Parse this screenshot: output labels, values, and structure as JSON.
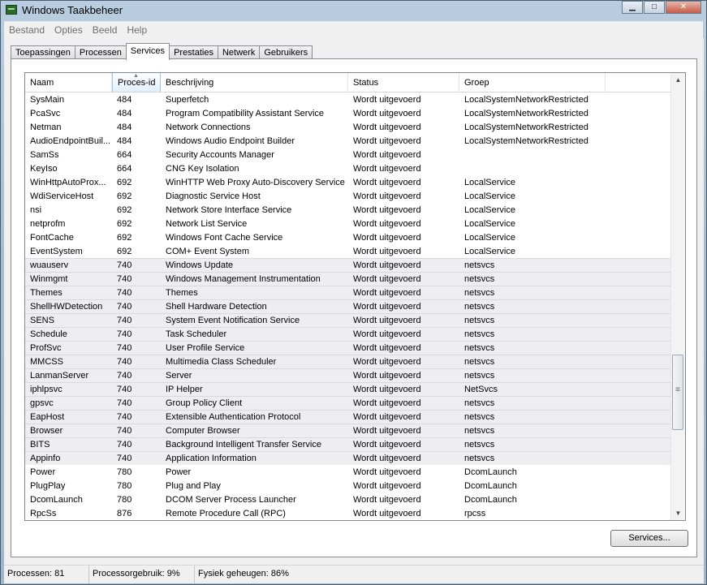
{
  "window": {
    "title": "Windows Taakbeheer",
    "min_glyph": "▁",
    "max_glyph": "□",
    "close_glyph": "✕"
  },
  "menu": [
    "Bestand",
    "Opties",
    "Beeld",
    "Help"
  ],
  "tabs": [
    "Toepassingen",
    "Processen",
    "Services",
    "Prestaties",
    "Netwerk",
    "Gebruikers"
  ],
  "active_tab": "Services",
  "columns": [
    "Naam",
    "Proces-id",
    "Beschrijving",
    "Status",
    "Groep"
  ],
  "sorted_column": "Proces-id",
  "rows": [
    [
      "SysMain",
      "484",
      "Superfetch",
      "Wordt uitgevoerd",
      "LocalSystemNetworkRestricted"
    ],
    [
      "PcaSvc",
      "484",
      "Program Compatibility Assistant Service",
      "Wordt uitgevoerd",
      "LocalSystemNetworkRestricted"
    ],
    [
      "Netman",
      "484",
      "Network Connections",
      "Wordt uitgevoerd",
      "LocalSystemNetworkRestricted"
    ],
    [
      "AudioEndpointBuil...",
      "484",
      "Windows Audio Endpoint Builder",
      "Wordt uitgevoerd",
      "LocalSystemNetworkRestricted"
    ],
    [
      "SamSs",
      "664",
      "Security Accounts Manager",
      "Wordt uitgevoerd",
      ""
    ],
    [
      "KeyIso",
      "664",
      "CNG Key Isolation",
      "Wordt uitgevoerd",
      ""
    ],
    [
      "WinHttpAutoProx...",
      "692",
      "WinHTTP Web Proxy Auto-Discovery Service",
      "Wordt uitgevoerd",
      "LocalService"
    ],
    [
      "WdiServiceHost",
      "692",
      "Diagnostic Service Host",
      "Wordt uitgevoerd",
      "LocalService"
    ],
    [
      "nsi",
      "692",
      "Network Store Interface Service",
      "Wordt uitgevoerd",
      "LocalService"
    ],
    [
      "netprofm",
      "692",
      "Network List Service",
      "Wordt uitgevoerd",
      "LocalService"
    ],
    [
      "FontCache",
      "692",
      "Windows Font Cache Service",
      "Wordt uitgevoerd",
      "LocalService"
    ],
    [
      "EventSystem",
      "692",
      "COM+ Event System",
      "Wordt uitgevoerd",
      "LocalService"
    ],
    [
      "wuauserv",
      "740",
      "Windows Update",
      "Wordt uitgevoerd",
      "netsvcs"
    ],
    [
      "Winmgmt",
      "740",
      "Windows Management Instrumentation",
      "Wordt uitgevoerd",
      "netsvcs"
    ],
    [
      "Themes",
      "740",
      "Themes",
      "Wordt uitgevoerd",
      "netsvcs"
    ],
    [
      "ShellHWDetection",
      "740",
      "Shell Hardware Detection",
      "Wordt uitgevoerd",
      "netsvcs"
    ],
    [
      "SENS",
      "740",
      "System Event Notification Service",
      "Wordt uitgevoerd",
      "netsvcs"
    ],
    [
      "Schedule",
      "740",
      "Task Scheduler",
      "Wordt uitgevoerd",
      "netsvcs"
    ],
    [
      "ProfSvc",
      "740",
      "User Profile Service",
      "Wordt uitgevoerd",
      "netsvcs"
    ],
    [
      "MMCSS",
      "740",
      "Multimedia Class Scheduler",
      "Wordt uitgevoerd",
      "netsvcs"
    ],
    [
      "LanmanServer",
      "740",
      "Server",
      "Wordt uitgevoerd",
      "netsvcs"
    ],
    [
      "iphlpsvc",
      "740",
      "IP Helper",
      "Wordt uitgevoerd",
      "NetSvcs"
    ],
    [
      "gpsvc",
      "740",
      "Group Policy Client",
      "Wordt uitgevoerd",
      "netsvcs"
    ],
    [
      "EapHost",
      "740",
      "Extensible Authentication Protocol",
      "Wordt uitgevoerd",
      "netsvcs"
    ],
    [
      "Browser",
      "740",
      "Computer Browser",
      "Wordt uitgevoerd",
      "netsvcs"
    ],
    [
      "BITS",
      "740",
      "Background Intelligent Transfer Service",
      "Wordt uitgevoerd",
      "netsvcs"
    ],
    [
      "Appinfo",
      "740",
      "Application Information",
      "Wordt uitgevoerd",
      "netsvcs"
    ],
    [
      "Power",
      "780",
      "Power",
      "Wordt uitgevoerd",
      "DcomLaunch"
    ],
    [
      "PlugPlay",
      "780",
      "Plug and Play",
      "Wordt uitgevoerd",
      "DcomLaunch"
    ],
    [
      "DcomLaunch",
      "780",
      "DCOM Server Process Launcher",
      "Wordt uitgevoerd",
      "DcomLaunch"
    ],
    [
      "RpcSs",
      "876",
      "Remote Procedure Call (RPC)",
      "Wordt uitgevoerd",
      "rpcss"
    ]
  ],
  "highlighted_group_pid": "740",
  "scrollbar": {
    "up_glyph": "▲",
    "down_glyph": "▼",
    "grip_glyph": "≡"
  },
  "services_button": "Services...",
  "statusbar": [
    "Processen: 81",
    "Processorgebruik: 9%",
    "Fysiek geheugen: 86%"
  ]
}
